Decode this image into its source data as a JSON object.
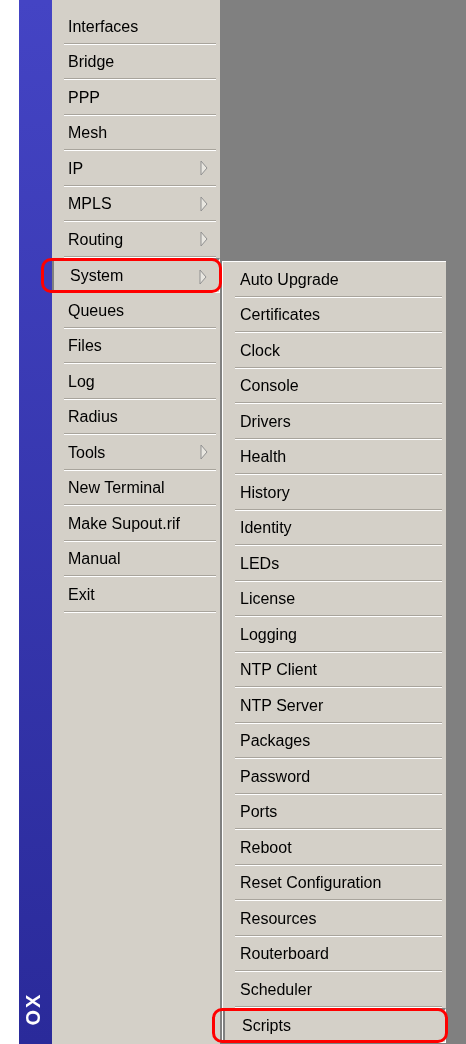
{
  "sidebar": {
    "label": "OX"
  },
  "menu": {
    "items": [
      {
        "label": "Interfaces",
        "has_submenu": false,
        "selected": false
      },
      {
        "label": "Bridge",
        "has_submenu": false,
        "selected": false
      },
      {
        "label": "PPP",
        "has_submenu": false,
        "selected": false
      },
      {
        "label": "Mesh",
        "has_submenu": false,
        "selected": false
      },
      {
        "label": "IP",
        "has_submenu": true,
        "selected": false
      },
      {
        "label": "MPLS",
        "has_submenu": true,
        "selected": false
      },
      {
        "label": "Routing",
        "has_submenu": true,
        "selected": false
      },
      {
        "label": "System",
        "has_submenu": true,
        "selected": true
      },
      {
        "label": "Queues",
        "has_submenu": false,
        "selected": false
      },
      {
        "label": "Files",
        "has_submenu": false,
        "selected": false
      },
      {
        "label": "Log",
        "has_submenu": false,
        "selected": false
      },
      {
        "label": "Radius",
        "has_submenu": false,
        "selected": false
      },
      {
        "label": "Tools",
        "has_submenu": true,
        "selected": false
      },
      {
        "label": "New Terminal",
        "has_submenu": false,
        "selected": false
      },
      {
        "label": "Make Supout.rif",
        "has_submenu": false,
        "selected": false
      },
      {
        "label": "Manual",
        "has_submenu": false,
        "selected": false
      },
      {
        "label": "Exit",
        "has_submenu": false,
        "selected": false
      }
    ]
  },
  "submenu": {
    "items": [
      {
        "label": "Auto Upgrade",
        "selected": false
      },
      {
        "label": "Certificates",
        "selected": false
      },
      {
        "label": "Clock",
        "selected": false
      },
      {
        "label": "Console",
        "selected": false
      },
      {
        "label": "Drivers",
        "selected": false
      },
      {
        "label": "Health",
        "selected": false
      },
      {
        "label": "History",
        "selected": false
      },
      {
        "label": "Identity",
        "selected": false
      },
      {
        "label": "LEDs",
        "selected": false
      },
      {
        "label": "License",
        "selected": false
      },
      {
        "label": "Logging",
        "selected": false
      },
      {
        "label": "NTP Client",
        "selected": false
      },
      {
        "label": "NTP Server",
        "selected": false
      },
      {
        "label": "Packages",
        "selected": false
      },
      {
        "label": "Password",
        "selected": false
      },
      {
        "label": "Ports",
        "selected": false
      },
      {
        "label": "Reboot",
        "selected": false
      },
      {
        "label": "Reset Configuration",
        "selected": false
      },
      {
        "label": "Resources",
        "selected": false
      },
      {
        "label": "Routerboard",
        "selected": false
      },
      {
        "label": "Scheduler",
        "selected": false
      },
      {
        "label": "Scripts",
        "selected": true
      }
    ]
  }
}
